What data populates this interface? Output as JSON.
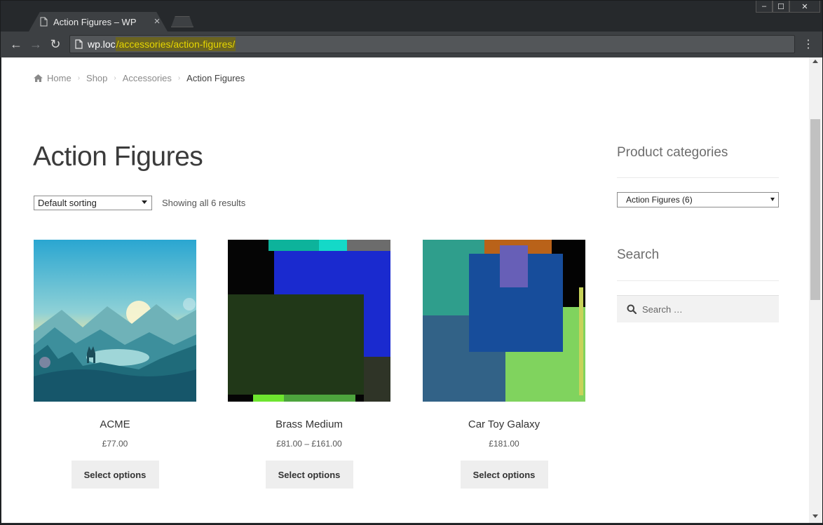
{
  "browser": {
    "tab_title": "Action Figures – WP",
    "tab_close": "×",
    "url_host": "wp.loc",
    "url_path": "/accessories/action-figures/",
    "back": "←",
    "forward": "→",
    "reload": "↻",
    "menu": "⋮",
    "window_controls": {
      "minimize": "–",
      "maximize": "☐",
      "close": "✕"
    }
  },
  "breadcrumb": {
    "home": "Home",
    "shop": "Shop",
    "accessories": "Accessories",
    "current": "Action Figures",
    "separator": "›"
  },
  "main": {
    "title": "Action Figures",
    "sorting": "Default sorting",
    "result_count": "Showing all 6 results"
  },
  "products": [
    {
      "name": "ACME",
      "price": "£77.00",
      "button": "Select options"
    },
    {
      "name": "Brass Medium",
      "price": "£81.00 – £161.00",
      "button": "Select options"
    },
    {
      "name": "Car Toy Galaxy",
      "price": "£181.00",
      "button": "Select options"
    }
  ],
  "sidebar": {
    "categories_title": "Product categories",
    "categories_selected": "Action Figures (6)",
    "search_title": "Search",
    "search_placeholder": "Search …"
  }
}
